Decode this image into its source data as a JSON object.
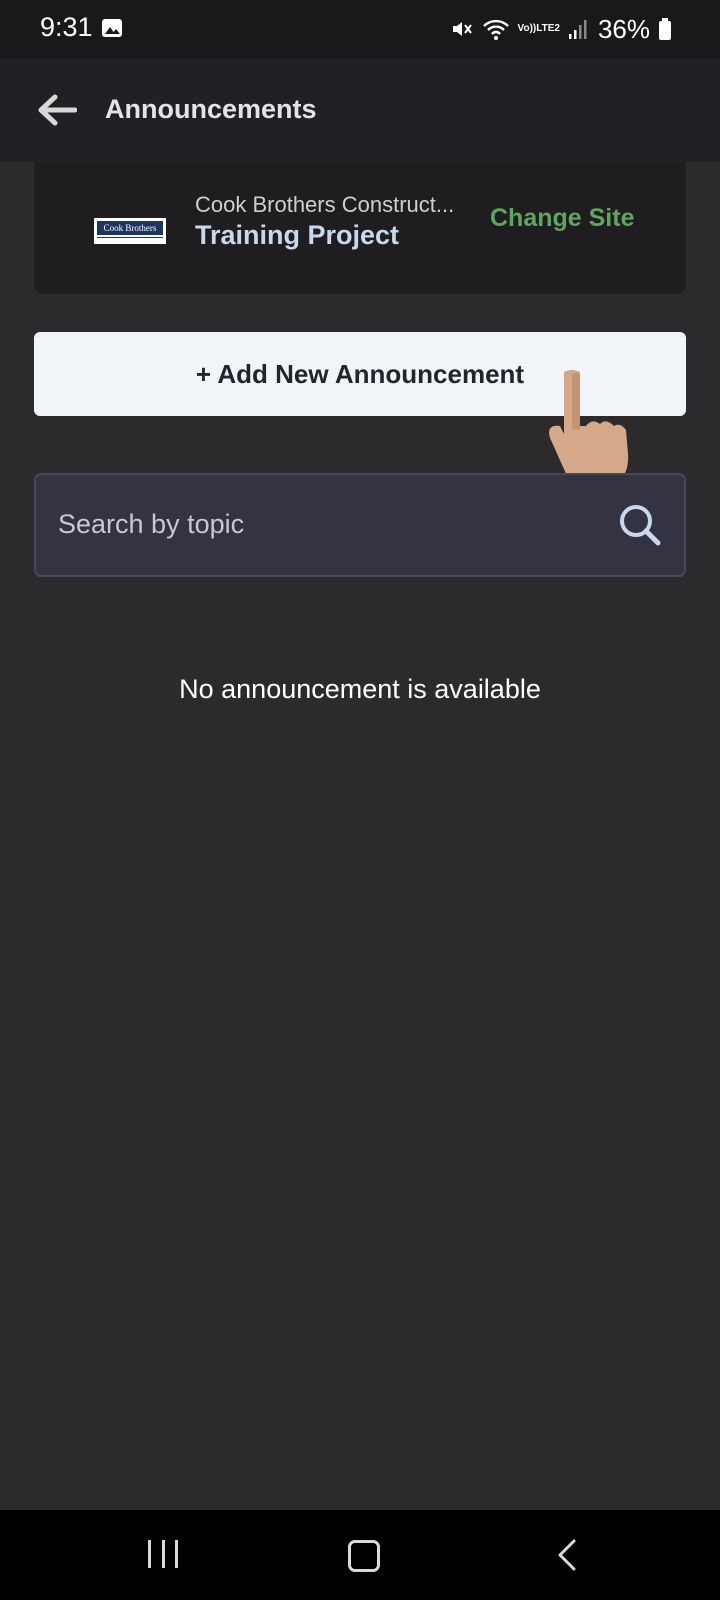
{
  "status_bar": {
    "time": "9:31",
    "lte_top": "Vo))",
    "lte_bottom": "LTE2",
    "battery": "36%"
  },
  "header": {
    "title": "Announcements"
  },
  "site": {
    "company": "Cook Brothers Construct...",
    "logo_text": "Cook Brothers",
    "project": "Training Project",
    "change_label": "Change Site"
  },
  "actions": {
    "add_label": "+ Add New Announcement"
  },
  "search": {
    "placeholder": "Search by topic",
    "value": ""
  },
  "empty_state": {
    "message": "No announcement is available"
  },
  "colors": {
    "background": "#2c2a2d",
    "accent_green": "#5ea55d",
    "button_bg": "#f0f5f9"
  }
}
